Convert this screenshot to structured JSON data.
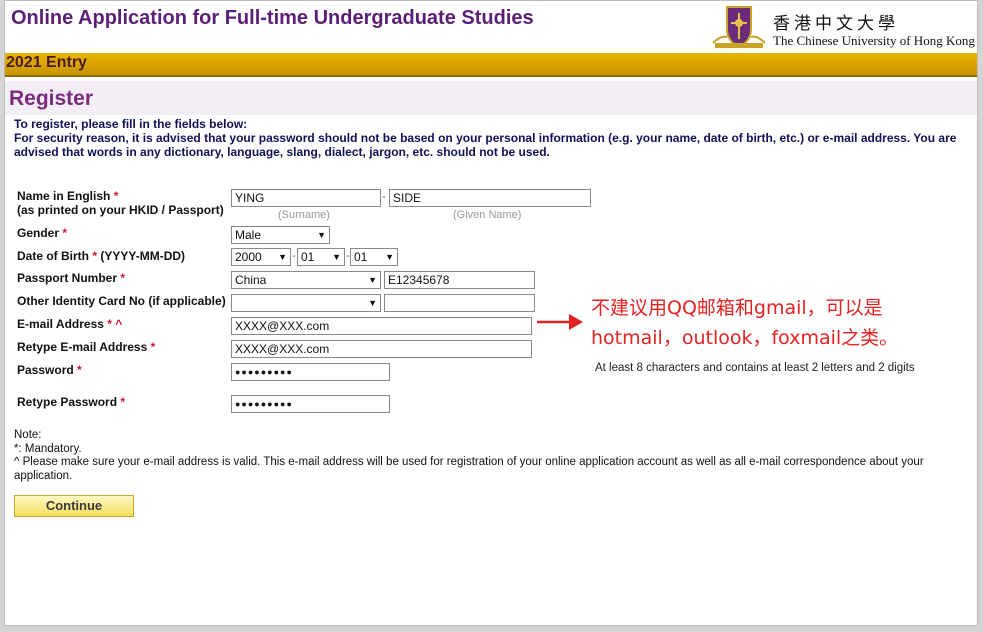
{
  "header": {
    "title": "Online Application for Full-time Undergraduate Studies",
    "logo_cn": "香港中文大學",
    "logo_en": "The Chinese University of Hong Kong"
  },
  "entry": "2021 Entry",
  "register": {
    "title": "Register",
    "intro_1": "To register, please fill in the fields below:",
    "intro_2": "For security reason, it is advised that your password should not be based on your personal information (e.g. your name, date of birth, etc.) or e-mail address. You are advised that words in any dictionary, language, slang, dialect, jargon, etc. should not be used."
  },
  "form": {
    "name_label_1": "Name in English",
    "name_label_2": "(as printed on your HKID / Passport)",
    "surname": "YING",
    "given_name": "SIDE",
    "surname_hint": "(Surname)",
    "given_hint": "(Given Name)",
    "gender_label": "Gender",
    "gender": "Male",
    "dob_label": "Date of Birth",
    "dob_format": "(YYYY-MM-DD)",
    "dob_year": "2000",
    "dob_month": "01",
    "dob_day": "01",
    "passport_label": "Passport Number",
    "passport_country": "China",
    "passport_number": "E12345678",
    "other_id_label": "Other Identity Card No (if applicable)",
    "other_id_type": "",
    "other_id_number": "",
    "email_label": "E-mail Address",
    "email": "XXXX@XXX.com",
    "retype_email_label": "Retype E-mail Address",
    "retype_email": "XXXX@XXX.com",
    "password_label": "Password",
    "password": "●●●●●●●●●",
    "retype_password_label": "Retype Password",
    "retype_password": "●●●●●●●●●",
    "password_hint": "At least 8 characters and contains at least 2 letters and 2 digits",
    "req_star": "*",
    "caret": "^",
    "dot": "-"
  },
  "annotation": {
    "line_1": "不建议用QQ邮箱和gmail，可以是",
    "line_2": "hotmail，outlook，foxmail之类。"
  },
  "notes": {
    "title": "Note:",
    "mandatory": "*: Mandatory.",
    "email_note": "^ Please make sure your e-mail address is valid. This e-mail address will be used for registration of your online application account as well as all e-mail correspondence about your application."
  },
  "continue_label": "Continue",
  "colors": {
    "title_purple": "#5c1f77",
    "gold_bar": "#d9a800",
    "annotation_red": "#e42222"
  }
}
